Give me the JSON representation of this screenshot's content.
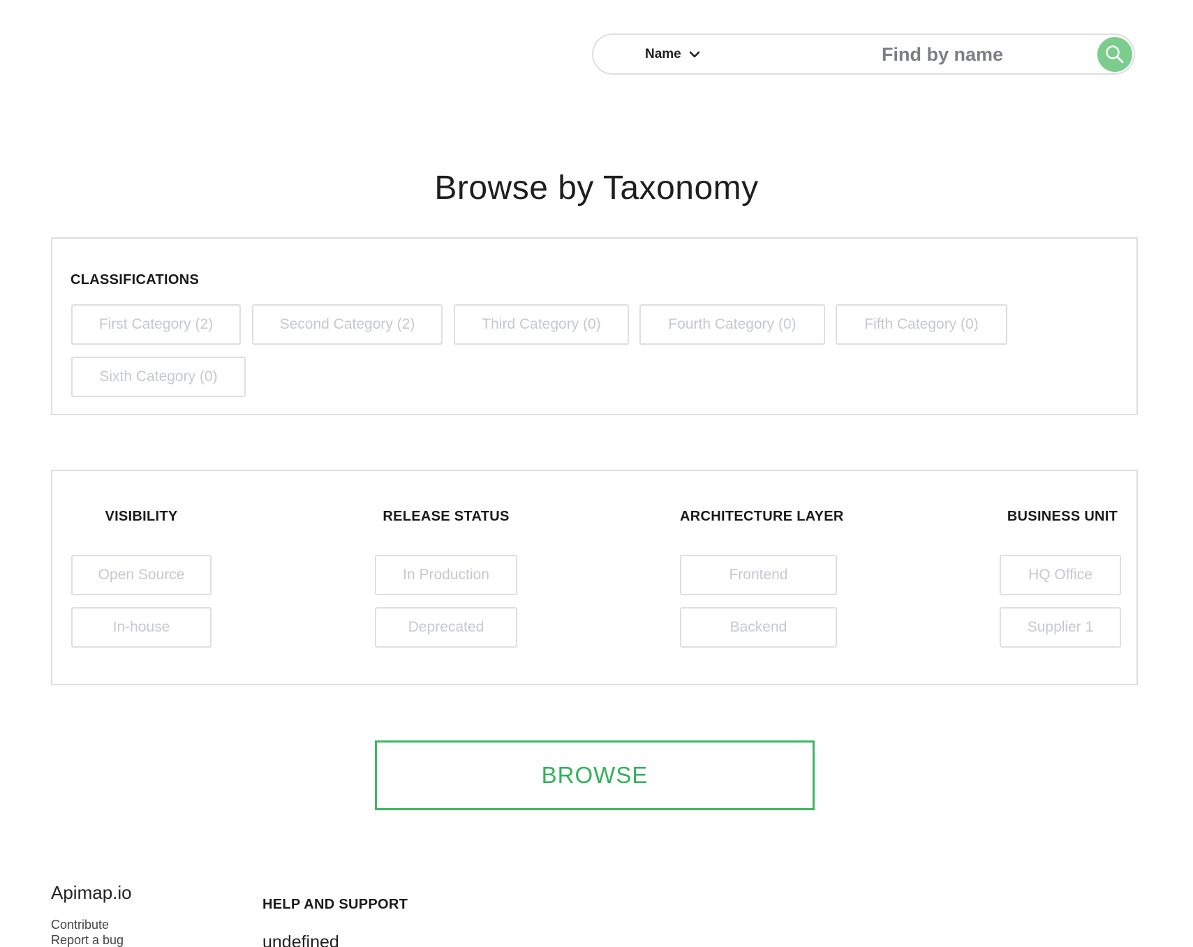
{
  "search": {
    "filter_label": "Name",
    "placeholder": "Find by name",
    "accent_color": "#7ccc8d"
  },
  "heading": "Browse by Taxonomy",
  "classifications": {
    "title": "CLASSIFICATIONS",
    "items": [
      "First Category (2)",
      "Second Category (2)",
      "Third Category (0)",
      "Fourth Category (0)",
      "Fifth Category (0)",
      "Sixth Category (0)"
    ]
  },
  "taxonomies": [
    {
      "title": "VISIBILITY",
      "options": [
        "Open Source",
        "In-house"
      ]
    },
    {
      "title": "RELEASE STATUS",
      "options": [
        "In Production",
        "Deprecated"
      ]
    },
    {
      "title": "ARCHITECTURE LAYER",
      "options": [
        "Frontend",
        "Backend"
      ]
    },
    {
      "title": "BUSINESS UNIT",
      "options": [
        "HQ Office",
        "Supplier 1"
      ]
    }
  ],
  "browse_button": {
    "label": "BROWSE",
    "color": "#33b15a"
  },
  "footer": {
    "brand": "Apimap.io",
    "links": [
      "Contribute",
      "Report a bug"
    ],
    "help_title": "HELP AND SUPPORT",
    "help_value": "undefined"
  }
}
